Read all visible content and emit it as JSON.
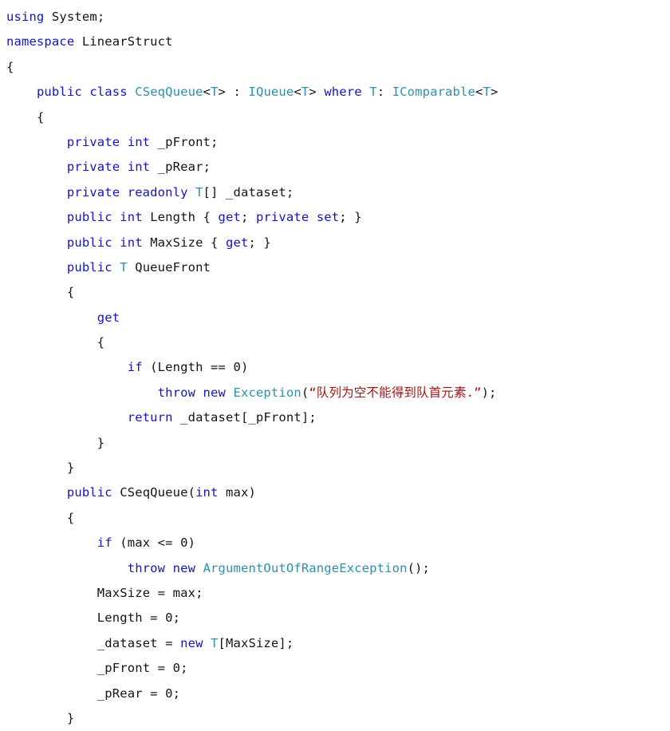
{
  "document": {
    "kind": "source-code-listing",
    "language": "C#",
    "background_color": "#ffffff",
    "colors": {
      "keyword": "#1414c8",
      "type": "#2b91af",
      "string": "#a31515",
      "identifier": "#141414",
      "punctuation": "#141414"
    },
    "indent_unit": "    ",
    "lines": [
      {
        "number": 1,
        "indent": 0,
        "text": "using System;",
        "tokens": [
          {
            "t": "using",
            "c": "kw"
          },
          {
            "t": " ",
            "c": "punc"
          },
          {
            "t": "System",
            "c": "id"
          },
          {
            "t": ";",
            "c": "punc"
          }
        ]
      },
      {
        "number": 2,
        "indent": 0,
        "text": "namespace LinearStruct",
        "tokens": [
          {
            "t": "namespace",
            "c": "kw"
          },
          {
            "t": " ",
            "c": "punc"
          },
          {
            "t": "LinearStruct",
            "c": "id"
          }
        ]
      },
      {
        "number": 3,
        "indent": 0,
        "text": "{",
        "tokens": [
          {
            "t": "{",
            "c": "punc"
          }
        ]
      },
      {
        "number": 4,
        "indent": 1,
        "text": "    public class CSeqQueue<T> : IQueue<T> where T: IComparable<T>",
        "tokens": [
          {
            "t": "    ",
            "c": "ind"
          },
          {
            "t": "public",
            "c": "kw"
          },
          {
            "t": " ",
            "c": "punc"
          },
          {
            "t": "class",
            "c": "kw"
          },
          {
            "t": " ",
            "c": "punc"
          },
          {
            "t": "CSeqQueue",
            "c": "type"
          },
          {
            "t": "<",
            "c": "punc"
          },
          {
            "t": "T",
            "c": "type"
          },
          {
            "t": ">",
            "c": "punc"
          },
          {
            "t": " : ",
            "c": "punc"
          },
          {
            "t": "IQueue",
            "c": "type"
          },
          {
            "t": "<",
            "c": "punc"
          },
          {
            "t": "T",
            "c": "type"
          },
          {
            "t": "> ",
            "c": "punc"
          },
          {
            "t": "where",
            "c": "kw"
          },
          {
            "t": " ",
            "c": "punc"
          },
          {
            "t": "T",
            "c": "type"
          },
          {
            "t": ": ",
            "c": "punc"
          },
          {
            "t": "IComparable",
            "c": "type"
          },
          {
            "t": "<",
            "c": "punc"
          },
          {
            "t": "T",
            "c": "type"
          },
          {
            "t": ">",
            "c": "punc"
          }
        ]
      },
      {
        "number": 5,
        "indent": 1,
        "text": "    {",
        "tokens": [
          {
            "t": "    ",
            "c": "ind"
          },
          {
            "t": "{",
            "c": "punc"
          }
        ]
      },
      {
        "number": 6,
        "indent": 2,
        "text": "        private int _pFront;",
        "tokens": [
          {
            "t": "        ",
            "c": "ind"
          },
          {
            "t": "private",
            "c": "kw"
          },
          {
            "t": " ",
            "c": "punc"
          },
          {
            "t": "int",
            "c": "kw"
          },
          {
            "t": " ",
            "c": "punc"
          },
          {
            "t": "_pFront",
            "c": "id"
          },
          {
            "t": ";",
            "c": "punc"
          }
        ]
      },
      {
        "number": 7,
        "indent": 2,
        "text": "        private int _pRear;",
        "tokens": [
          {
            "t": "        ",
            "c": "ind"
          },
          {
            "t": "private",
            "c": "kw"
          },
          {
            "t": " ",
            "c": "punc"
          },
          {
            "t": "int",
            "c": "kw"
          },
          {
            "t": " ",
            "c": "punc"
          },
          {
            "t": "_pRear",
            "c": "id"
          },
          {
            "t": ";",
            "c": "punc"
          }
        ]
      },
      {
        "number": 8,
        "indent": 2,
        "text": "        private readonly T[] _dataset;",
        "tokens": [
          {
            "t": "        ",
            "c": "ind"
          },
          {
            "t": "private",
            "c": "kw"
          },
          {
            "t": " ",
            "c": "punc"
          },
          {
            "t": "readonly",
            "c": "kw"
          },
          {
            "t": " ",
            "c": "punc"
          },
          {
            "t": "T",
            "c": "type"
          },
          {
            "t": "[] ",
            "c": "punc"
          },
          {
            "t": "_dataset",
            "c": "id"
          },
          {
            "t": ";",
            "c": "punc"
          }
        ]
      },
      {
        "number": 9,
        "indent": 2,
        "text": "        public int Length { get; private set; }",
        "tokens": [
          {
            "t": "        ",
            "c": "ind"
          },
          {
            "t": "public",
            "c": "kw"
          },
          {
            "t": " ",
            "c": "punc"
          },
          {
            "t": "int",
            "c": "kw"
          },
          {
            "t": " ",
            "c": "punc"
          },
          {
            "t": "Length",
            "c": "id"
          },
          {
            "t": " { ",
            "c": "punc"
          },
          {
            "t": "get",
            "c": "kw"
          },
          {
            "t": "; ",
            "c": "punc"
          },
          {
            "t": "private",
            "c": "kw"
          },
          {
            "t": " ",
            "c": "punc"
          },
          {
            "t": "set",
            "c": "kw"
          },
          {
            "t": "; }",
            "c": "punc"
          }
        ]
      },
      {
        "number": 10,
        "indent": 2,
        "text": "        public int MaxSize { get; }",
        "tokens": [
          {
            "t": "        ",
            "c": "ind"
          },
          {
            "t": "public",
            "c": "kw"
          },
          {
            "t": " ",
            "c": "punc"
          },
          {
            "t": "int",
            "c": "kw"
          },
          {
            "t": " ",
            "c": "punc"
          },
          {
            "t": "MaxSize",
            "c": "id"
          },
          {
            "t": " { ",
            "c": "punc"
          },
          {
            "t": "get",
            "c": "kw"
          },
          {
            "t": "; }",
            "c": "punc"
          }
        ]
      },
      {
        "number": 11,
        "indent": 2,
        "text": "        public T QueueFront",
        "tokens": [
          {
            "t": "        ",
            "c": "ind"
          },
          {
            "t": "public",
            "c": "kw"
          },
          {
            "t": " ",
            "c": "punc"
          },
          {
            "t": "T",
            "c": "type"
          },
          {
            "t": " ",
            "c": "punc"
          },
          {
            "t": "QueueFront",
            "c": "id"
          }
        ]
      },
      {
        "number": 12,
        "indent": 2,
        "text": "        {",
        "tokens": [
          {
            "t": "        ",
            "c": "ind"
          },
          {
            "t": "{",
            "c": "punc"
          }
        ]
      },
      {
        "number": 13,
        "indent": 3,
        "text": "            get",
        "tokens": [
          {
            "t": "            ",
            "c": "ind"
          },
          {
            "t": "get",
            "c": "kw"
          }
        ]
      },
      {
        "number": 14,
        "indent": 3,
        "text": "            {",
        "tokens": [
          {
            "t": "            ",
            "c": "ind"
          },
          {
            "t": "{",
            "c": "punc"
          }
        ]
      },
      {
        "number": 15,
        "indent": 4,
        "text": "                if (Length == 0)",
        "tokens": [
          {
            "t": "                ",
            "c": "ind"
          },
          {
            "t": "if",
            "c": "kw"
          },
          {
            "t": " (",
            "c": "punc"
          },
          {
            "t": "Length",
            "c": "id"
          },
          {
            "t": " == ",
            "c": "punc"
          },
          {
            "t": "0",
            "c": "num"
          },
          {
            "t": ")",
            "c": "punc"
          }
        ]
      },
      {
        "number": 16,
        "indent": 5,
        "text": "                    throw new Exception(“队列为空不能得到队首元素.”);",
        "tokens": [
          {
            "t": "                    ",
            "c": "ind"
          },
          {
            "t": "throw",
            "c": "kw"
          },
          {
            "t": " ",
            "c": "punc"
          },
          {
            "t": "new",
            "c": "kw"
          },
          {
            "t": " ",
            "c": "punc"
          },
          {
            "t": "Exception",
            "c": "type"
          },
          {
            "t": "(",
            "c": "punc"
          },
          {
            "t": "“队列为空不能得到队首元素.”",
            "c": "str"
          },
          {
            "t": ");",
            "c": "punc"
          }
        ]
      },
      {
        "number": 17,
        "indent": 4,
        "text": "                return _dataset[_pFront];",
        "tokens": [
          {
            "t": "                ",
            "c": "ind"
          },
          {
            "t": "return",
            "c": "kw"
          },
          {
            "t": " ",
            "c": "punc"
          },
          {
            "t": "_dataset",
            "c": "id"
          },
          {
            "t": "[",
            "c": "punc"
          },
          {
            "t": "_pFront",
            "c": "id"
          },
          {
            "t": "];",
            "c": "punc"
          }
        ]
      },
      {
        "number": 18,
        "indent": 3,
        "text": "            }",
        "tokens": [
          {
            "t": "            ",
            "c": "ind"
          },
          {
            "t": "}",
            "c": "punc"
          }
        ]
      },
      {
        "number": 19,
        "indent": 2,
        "text": "        }",
        "tokens": [
          {
            "t": "        ",
            "c": "ind"
          },
          {
            "t": "}",
            "c": "punc"
          }
        ]
      },
      {
        "number": 20,
        "indent": 2,
        "text": "        public CSeqQueue(int max)",
        "tokens": [
          {
            "t": "        ",
            "c": "ind"
          },
          {
            "t": "public",
            "c": "kw"
          },
          {
            "t": " ",
            "c": "punc"
          },
          {
            "t": "CSeqQueue",
            "c": "id"
          },
          {
            "t": "(",
            "c": "punc"
          },
          {
            "t": "int",
            "c": "kw"
          },
          {
            "t": " ",
            "c": "punc"
          },
          {
            "t": "max",
            "c": "id"
          },
          {
            "t": ")",
            "c": "punc"
          }
        ]
      },
      {
        "number": 21,
        "indent": 2,
        "text": "        {",
        "tokens": [
          {
            "t": "        ",
            "c": "ind"
          },
          {
            "t": "{",
            "c": "punc"
          }
        ]
      },
      {
        "number": 22,
        "indent": 3,
        "text": "            if (max <= 0)",
        "tokens": [
          {
            "t": "            ",
            "c": "ind"
          },
          {
            "t": "if",
            "c": "kw"
          },
          {
            "t": " (",
            "c": "punc"
          },
          {
            "t": "max",
            "c": "id"
          },
          {
            "t": " <= ",
            "c": "punc"
          },
          {
            "t": "0",
            "c": "num"
          },
          {
            "t": ")",
            "c": "punc"
          }
        ]
      },
      {
        "number": 23,
        "indent": 4,
        "text": "                throw new ArgumentOutOfRangeException();",
        "tokens": [
          {
            "t": "                ",
            "c": "ind"
          },
          {
            "t": "throw",
            "c": "kw"
          },
          {
            "t": " ",
            "c": "punc"
          },
          {
            "t": "new",
            "c": "kw"
          },
          {
            "t": " ",
            "c": "punc"
          },
          {
            "t": "ArgumentOutOfRangeException",
            "c": "type"
          },
          {
            "t": "();",
            "c": "punc"
          }
        ]
      },
      {
        "number": 24,
        "indent": 3,
        "text": "            MaxSize = max;",
        "tokens": [
          {
            "t": "            ",
            "c": "ind"
          },
          {
            "t": "MaxSize",
            "c": "id"
          },
          {
            "t": " = ",
            "c": "punc"
          },
          {
            "t": "max",
            "c": "id"
          },
          {
            "t": ";",
            "c": "punc"
          }
        ]
      },
      {
        "number": 25,
        "indent": 3,
        "text": "            Length = 0;",
        "tokens": [
          {
            "t": "            ",
            "c": "ind"
          },
          {
            "t": "Length",
            "c": "id"
          },
          {
            "t": " = ",
            "c": "punc"
          },
          {
            "t": "0",
            "c": "num"
          },
          {
            "t": ";",
            "c": "punc"
          }
        ]
      },
      {
        "number": 26,
        "indent": 3,
        "text": "            _dataset = new T[MaxSize];",
        "tokens": [
          {
            "t": "            ",
            "c": "ind"
          },
          {
            "t": "_dataset",
            "c": "id"
          },
          {
            "t": " = ",
            "c": "punc"
          },
          {
            "t": "new",
            "c": "kw"
          },
          {
            "t": " ",
            "c": "punc"
          },
          {
            "t": "T",
            "c": "type"
          },
          {
            "t": "[",
            "c": "punc"
          },
          {
            "t": "MaxSize",
            "c": "id"
          },
          {
            "t": "];",
            "c": "punc"
          }
        ]
      },
      {
        "number": 27,
        "indent": 3,
        "text": "            _pFront = 0;",
        "tokens": [
          {
            "t": "            ",
            "c": "ind"
          },
          {
            "t": "_pFront",
            "c": "id"
          },
          {
            "t": " = ",
            "c": "punc"
          },
          {
            "t": "0",
            "c": "num"
          },
          {
            "t": ";",
            "c": "punc"
          }
        ]
      },
      {
        "number": 28,
        "indent": 3,
        "text": "            _pRear = 0;",
        "tokens": [
          {
            "t": "            ",
            "c": "ind"
          },
          {
            "t": "_pRear",
            "c": "id"
          },
          {
            "t": " = ",
            "c": "punc"
          },
          {
            "t": "0",
            "c": "num"
          },
          {
            "t": ";",
            "c": "punc"
          }
        ]
      },
      {
        "number": 29,
        "indent": 2,
        "text": "        }",
        "tokens": [
          {
            "t": "        ",
            "c": "ind"
          },
          {
            "t": "}",
            "c": "punc"
          }
        ]
      }
    ]
  }
}
